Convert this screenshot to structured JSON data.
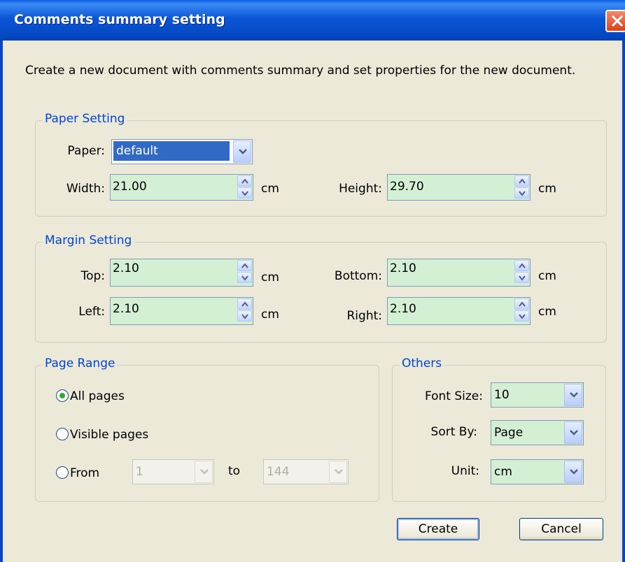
{
  "window": {
    "title": "Comments summary setting"
  },
  "description": "Create a new document with comments summary and set properties for the new document.",
  "paper_setting": {
    "legend": "Paper Setting",
    "paper_label": "Paper:",
    "paper_value": "default",
    "width_label": "Width:",
    "width_value": "21.00",
    "width_unit": "cm",
    "height_label": "Height:",
    "height_value": "29.70",
    "height_unit": "cm"
  },
  "margin_setting": {
    "legend": "Margin Setting",
    "top_label": "Top:",
    "top_value": "2.10",
    "top_unit": "cm",
    "bottom_label": "Bottom:",
    "bottom_value": "2.10",
    "bottom_unit": "cm",
    "left_label": "Left:",
    "left_value": "2.10",
    "left_unit": "cm",
    "right_label": "Right:",
    "right_value": "2.10",
    "right_unit": "cm"
  },
  "page_range": {
    "legend": "Page Range",
    "all_pages": "All pages",
    "visible_pages": "Visible pages",
    "from_label": "From",
    "from_value": "1",
    "to_label": "to",
    "to_value": "144",
    "selected": "all_pages"
  },
  "others": {
    "legend": "Others",
    "font_size_label": "Font Size:",
    "font_size_value": "10",
    "sort_by_label": "Sort By:",
    "sort_by_value": "Page",
    "unit_label": "Unit:",
    "unit_value": "cm"
  },
  "buttons": {
    "create": "Create",
    "cancel": "Cancel"
  },
  "colors": {
    "title_bar": "#0b56d6",
    "field_bg": "#d4f0d4",
    "legend_text": "#0046d5",
    "selection": "#316ac5",
    "dialog_bg": "#ece9d8"
  }
}
